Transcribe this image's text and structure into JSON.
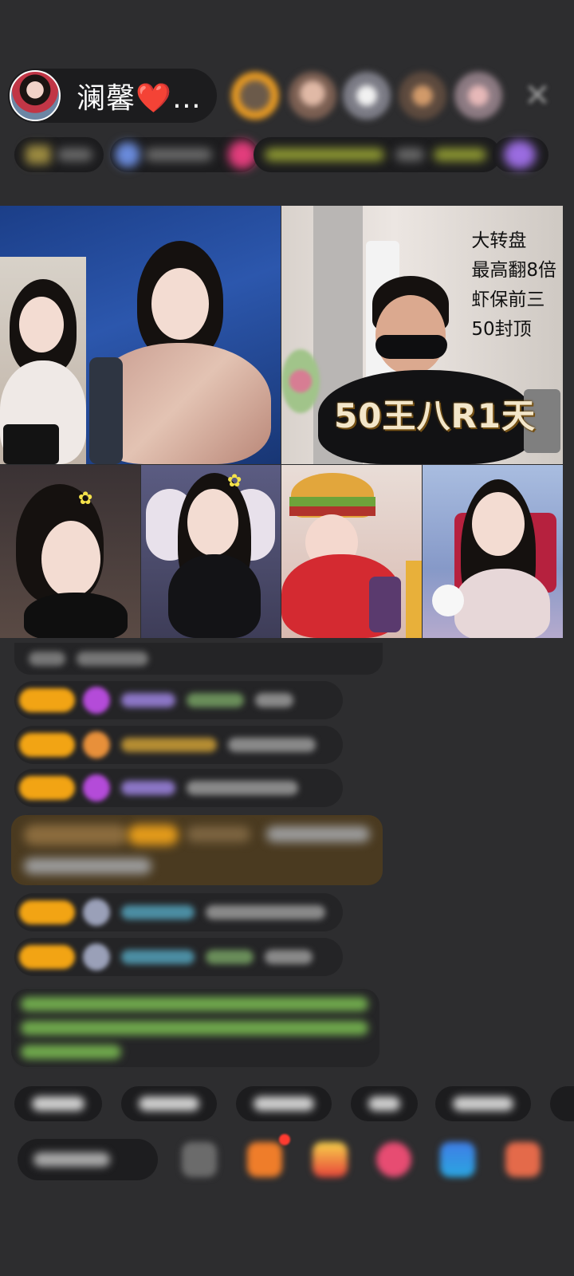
{
  "header": {
    "host_name": "澜馨",
    "host_heart": "❤️",
    "host_suffix": "…",
    "close_glyph": "✕"
  },
  "video_grid": {
    "big_tile": {
      "overlay_lines": [
        "大转盘",
        "最高翻8倍",
        "虾保前三",
        "50封顶"
      ],
      "caption": "50王八R1天"
    }
  },
  "colors": {
    "badge": "#f2a414",
    "chat_bg": "#242426",
    "page_bg": "#2d2d2f",
    "welcome_text": "#6fa84c"
  },
  "icons": [
    "close-icon",
    "flower-icon",
    "crown-icon",
    "gift-icon",
    "heart-icon",
    "share-icon"
  ]
}
